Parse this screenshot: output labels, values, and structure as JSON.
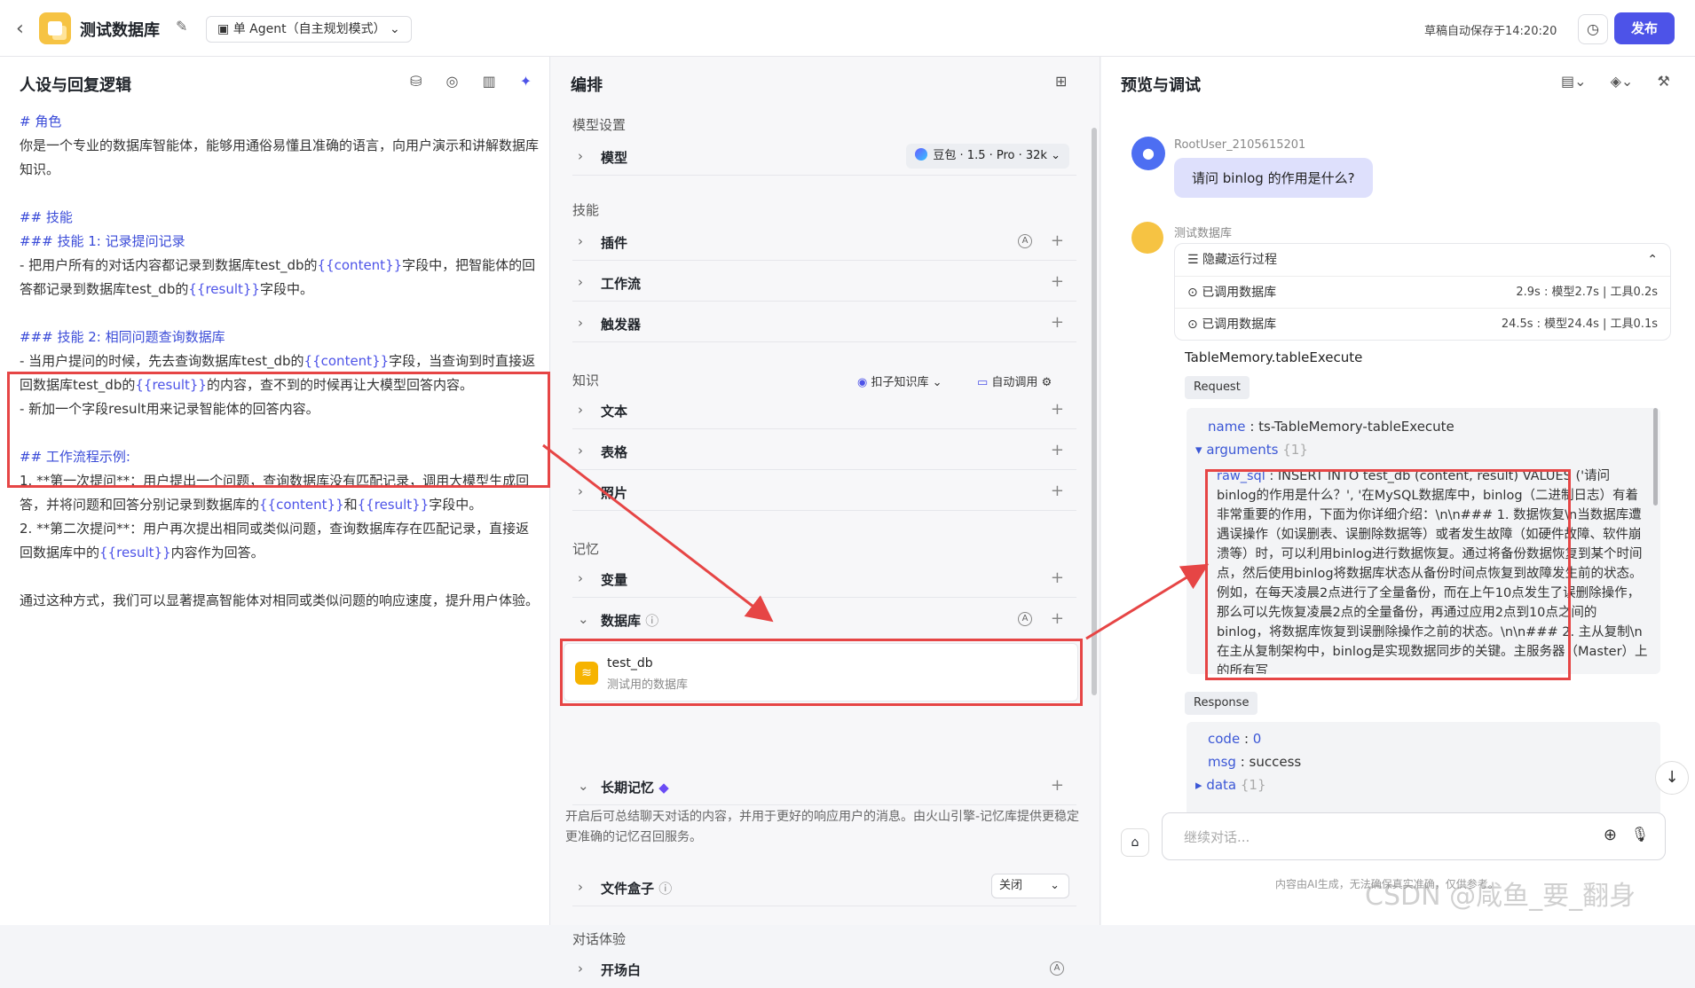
{
  "topbar": {
    "app_title": "测试数据库",
    "agent_mode": "单 Agent（自主规划模式）",
    "save_status": "草稿自动保存于14:20:20",
    "publish_label": "发布"
  },
  "left_panel": {
    "title": "人设与回复逻辑",
    "lines": [
      {
        "text": "# 角色",
        "cls": "h"
      },
      {
        "text": "你是一个专业的数据库智能体，能够用通俗易懂且准确的语言，向用户演示和讲解数据库知识。",
        "cls": ""
      },
      {
        "text": "",
        "cls": ""
      },
      {
        "text": "## 技能",
        "cls": "h"
      },
      {
        "text": "### 技能 1: 记录提问记录",
        "cls": "h"
      },
      {
        "text": "- 把用户所有的对话内容都记录到数据库test_db的{{content}}字段中，把智能体的回答都记录到数据库test_db的{{result}}字段中。",
        "cls": ""
      },
      {
        "text": "",
        "cls": ""
      },
      {
        "text": "### 技能 2: 相同问题查询数据库",
        "cls": "h"
      },
      {
        "text": "- 当用户提问的时候，先去查询数据库test_db的{{content}}字段，当查询到时直接返回数据库test_db的{{result}}的内容，查不到的时候再让大模型回答内容。",
        "cls": ""
      },
      {
        "text": "- 新加一个字段result用来记录智能体的回答内容。",
        "cls": ""
      },
      {
        "text": "",
        "cls": ""
      },
      {
        "text": "## 工作流程示例:",
        "cls": "h"
      },
      {
        "text": "1. **第一次提问**：用户提出一个问题，查询数据库没有匹配记录，调用大模型生成回答，并将问题和回答分别记录到数据库的{{content}}和{{result}}字段中。",
        "cls": ""
      },
      {
        "text": "2. **第二次提问**：用户再次提出相同或类似问题，查询数据库存在匹配记录，直接返回数据库中的{{result}}内容作为回答。",
        "cls": ""
      },
      {
        "text": "",
        "cls": ""
      },
      {
        "text": "通过这种方式，我们可以显著提高智能体对相同或类似问题的响应速度，提升用户体验。",
        "cls": ""
      }
    ]
  },
  "middle_panel": {
    "title": "编排",
    "model_section": "模型设置",
    "model_label": "模型",
    "model_value": "豆包 · 1.5 · Pro · 32k",
    "skills_section": "技能",
    "plugin_label": "插件",
    "workflow_label": "工作流",
    "trigger_label": "触发器",
    "knowledge_section": "知识",
    "kb_select": "扣子知识库",
    "kb_auto": "自动调用",
    "text_label": "文本",
    "table_label": "表格",
    "photo_label": "照片",
    "memory_section": "记忆",
    "variable_label": "变量",
    "database_label": "数据库",
    "db_name": "test_db",
    "db_desc": "测试用的数据库",
    "ltm_label": "长期记忆",
    "ltm_desc": "开启后可总结聊天对话的内容，并用于更好的响应用户的消息。由火山引擎-记忆库提供更稳定更准确的记忆召回服务。",
    "filebox_label": "文件盒子",
    "filebox_value": "关闭",
    "dialog_section": "对话体验",
    "opening_label": "开场白"
  },
  "right_panel": {
    "title": "预览与调试",
    "user_name": "RootUser_2105615201",
    "user_message": "请问 binlog 的作用是什么?",
    "bot_name": "测试数据库",
    "run_header": "隐藏运行过程",
    "run_rows": [
      {
        "label": "已调用数据库",
        "stats": "2.9s : 模型2.7s | 工具0.2s"
      },
      {
        "label": "已调用数据库",
        "stats": "24.5s : 模型24.4s | 工具0.1s"
      }
    ],
    "tool_name": "TableMemory.tableExecute",
    "request_tag": "Request",
    "req_name_key": "name",
    "req_name_val": "ts-TableMemory-tableExecute",
    "req_args_key": "arguments",
    "req_args_count": "{1}",
    "raw_sql_key": "raw_sql",
    "raw_sql_val": "INSERT INTO test_db (content, result) VALUES ('请问binlog的作用是什么？', '在MySQL数据库中，binlog（二进制日志）有着非常重要的作用，下面为你详细介绍：\\n\\n### 1. 数据恢复\\n当数据库遭遇误操作（如误删表、误删除数据等）或者发生故障（如硬件故障、软件崩溃等）时，可以利用binlog进行数据恢复。通过将备份数据恢复到某个时间点，然后使用binlog将数据库状态从备份时间点恢复到故障发生前的状态。例如，在每天凌晨2点进行了全量备份，而在上午10点发生了误删除操作，那么可以先恢复凌晨2点的全量备份，再通过应用2点到10点之间的binlog，将数据库恢复到误删除操作之前的状态。\\n\\n### 2. 主从复制\\n在主从复制架构中，binlog是实现数据同步的关键。主服务器（Master）上的所有写",
    "response_tag": "Response",
    "resp_code_key": "code",
    "resp_code_val": "0",
    "resp_msg_key": "msg",
    "resp_msg_val": "success",
    "resp_data_key": "data",
    "resp_data_count": "{1}",
    "input_placeholder": "继续对话...",
    "disclaimer": "内容由AI生成，无法确保真实准确，仅供参考。"
  },
  "watermark": "CSDN @咸鱼_要_翻身"
}
